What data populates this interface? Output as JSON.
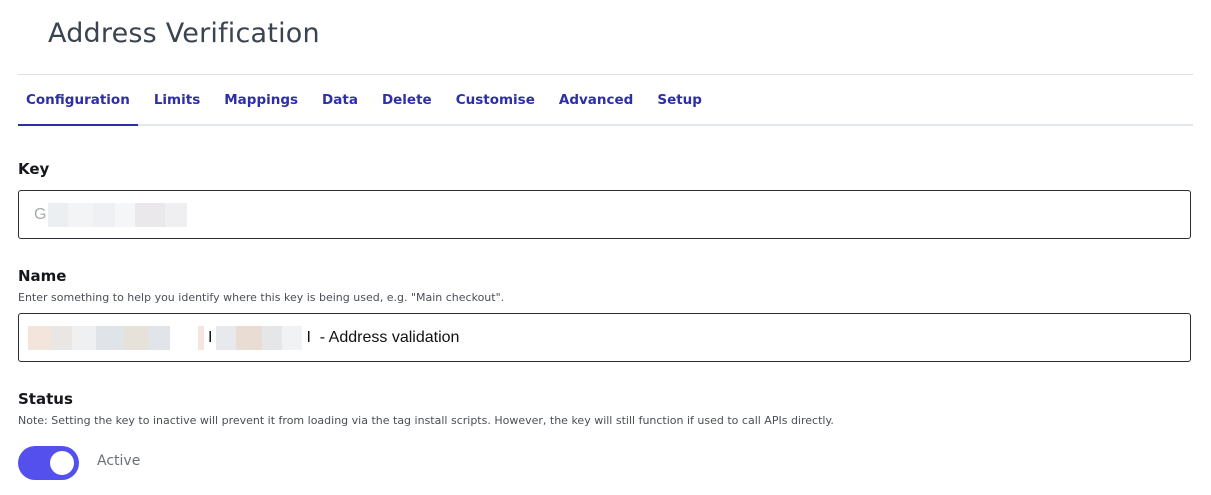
{
  "page": {
    "title": "Address Verification"
  },
  "tabs": [
    {
      "label": "Configuration",
      "active": true
    },
    {
      "label": "Limits"
    },
    {
      "label": "Mappings"
    },
    {
      "label": "Data"
    },
    {
      "label": "Delete"
    },
    {
      "label": "Customise"
    },
    {
      "label": "Advanced"
    },
    {
      "label": "Setup"
    }
  ],
  "key": {
    "label": "Key",
    "value_visible": "G"
  },
  "name": {
    "label": "Name",
    "help": "Enter something to help you identify where this key is being used, e.g. \"Main checkout\".",
    "value_separator": "I",
    "value_suffix": "I  - Address validation"
  },
  "status": {
    "label": "Status",
    "help": "Note: Setting the key to inactive will prevent it from loading via the tag install scripts. However, the key will still function if used to call APIs directly.",
    "toggle_on": true,
    "toggle_label": "Active"
  },
  "colors": {
    "accent": "#2d2fa6",
    "toggle": "#5350ee"
  }
}
